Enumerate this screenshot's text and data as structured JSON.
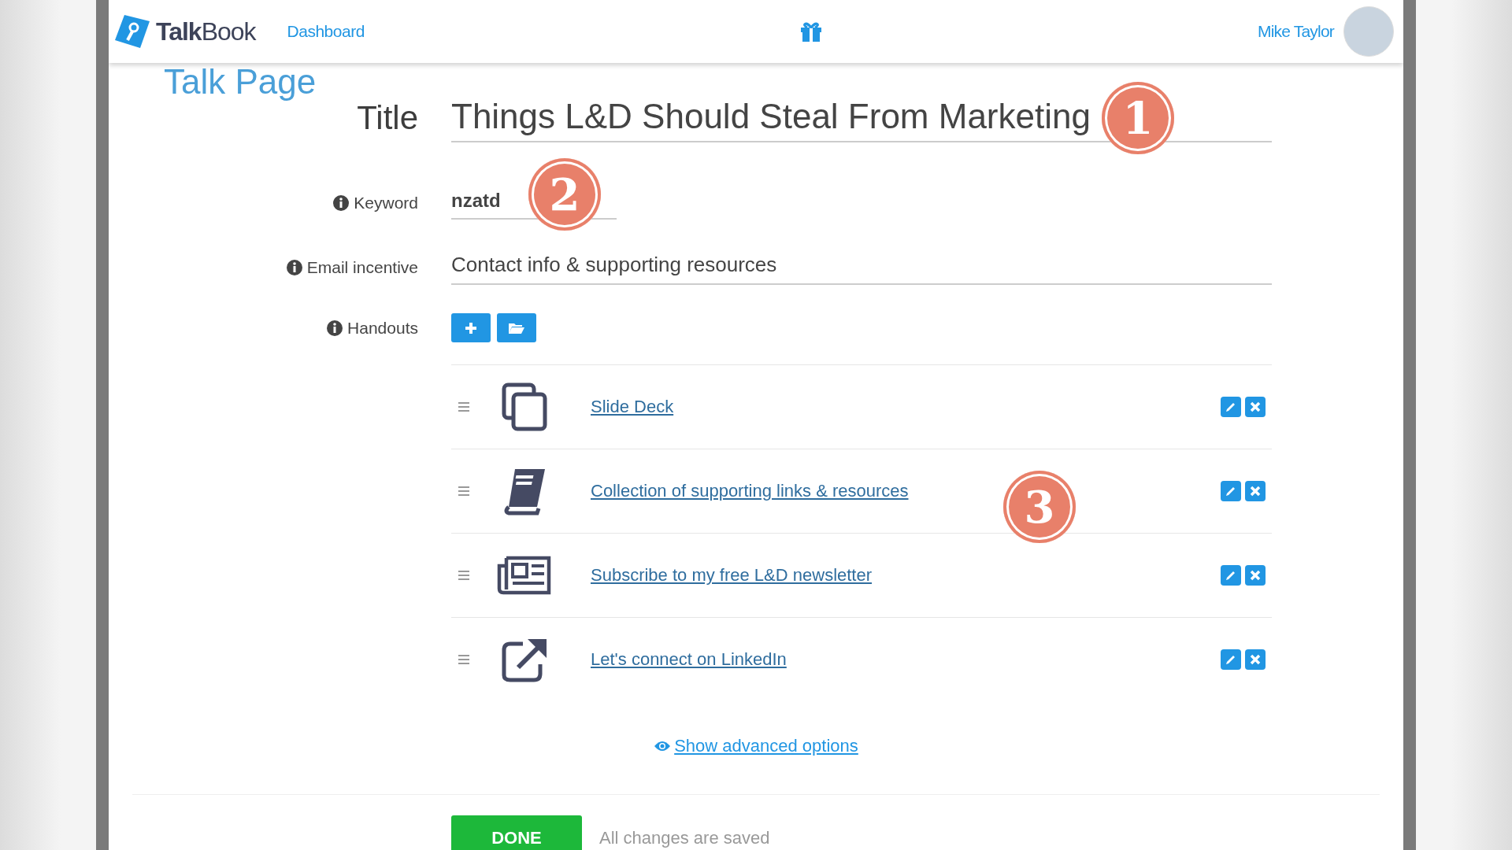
{
  "header": {
    "brand_bold": "Talk",
    "brand_light": "Book",
    "nav_link": "Dashboard",
    "user_name": "Mike Taylor"
  },
  "page_heading": "Talk Page",
  "title": {
    "label": "Title",
    "value": "Things L&D Should Steal From Marketing"
  },
  "fields": [
    {
      "label": "Keyword",
      "value": "nzatd",
      "kind": "short"
    },
    {
      "label": "Email incentive",
      "value": "Contact info & supporting resources",
      "kind": "wide"
    }
  ],
  "handouts_label": "Handouts",
  "handouts": [
    {
      "kind": "slides",
      "label": "Slide Deck"
    },
    {
      "kind": "book",
      "label": "Collection of supporting links & resources"
    },
    {
      "kind": "newsletter",
      "label": "Subscribe to my free L&D newsletter"
    },
    {
      "kind": "external",
      "label": "Let's connect on LinkedIn"
    }
  ],
  "advanced_link": "Show advanced options",
  "done_button": "DONE",
  "save_status": "All changes are saved",
  "callouts": [
    "1",
    "2",
    "3"
  ]
}
